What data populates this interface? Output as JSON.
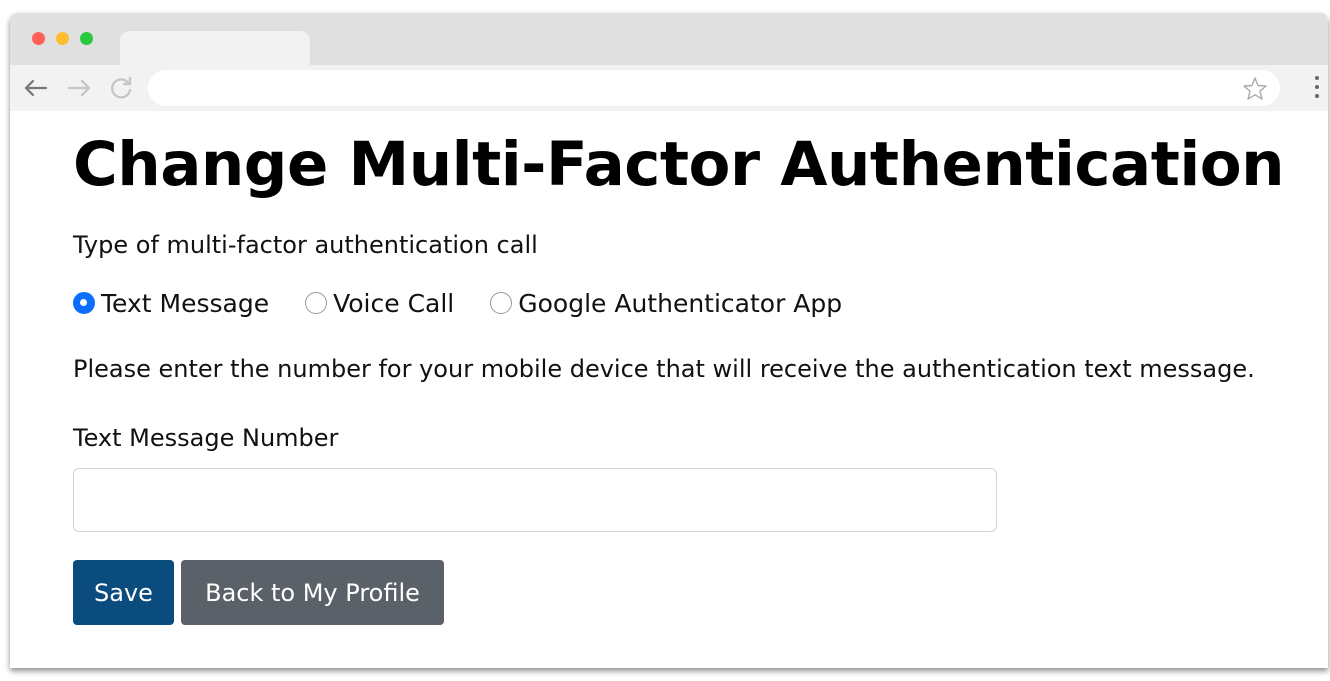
{
  "browser": {
    "icons": {
      "back": "arrow-left-icon",
      "forward": "arrow-right-icon",
      "reload": "reload-icon",
      "bookmark": "star-icon",
      "menu": "kebab-menu-icon"
    },
    "address_value": ""
  },
  "page": {
    "title": "Change Multi-Factor Authentication",
    "type_label": "Type of multi-factor authentication call",
    "radio_options": [
      {
        "label": "Text Message",
        "checked": true
      },
      {
        "label": "Voice Call",
        "checked": false
      },
      {
        "label": "Google Authenticator App",
        "checked": false
      }
    ],
    "instruction": "Please enter the number for your mobile device that will receive the authentication text message.",
    "field_label": "Text Message Number",
    "field_value": "",
    "buttons": {
      "save": "Save",
      "back": "Back to My Profile"
    }
  },
  "colors": {
    "primary": "#0a4c7d",
    "secondary": "#5b6168",
    "radio_checked": "#0d6efd"
  }
}
